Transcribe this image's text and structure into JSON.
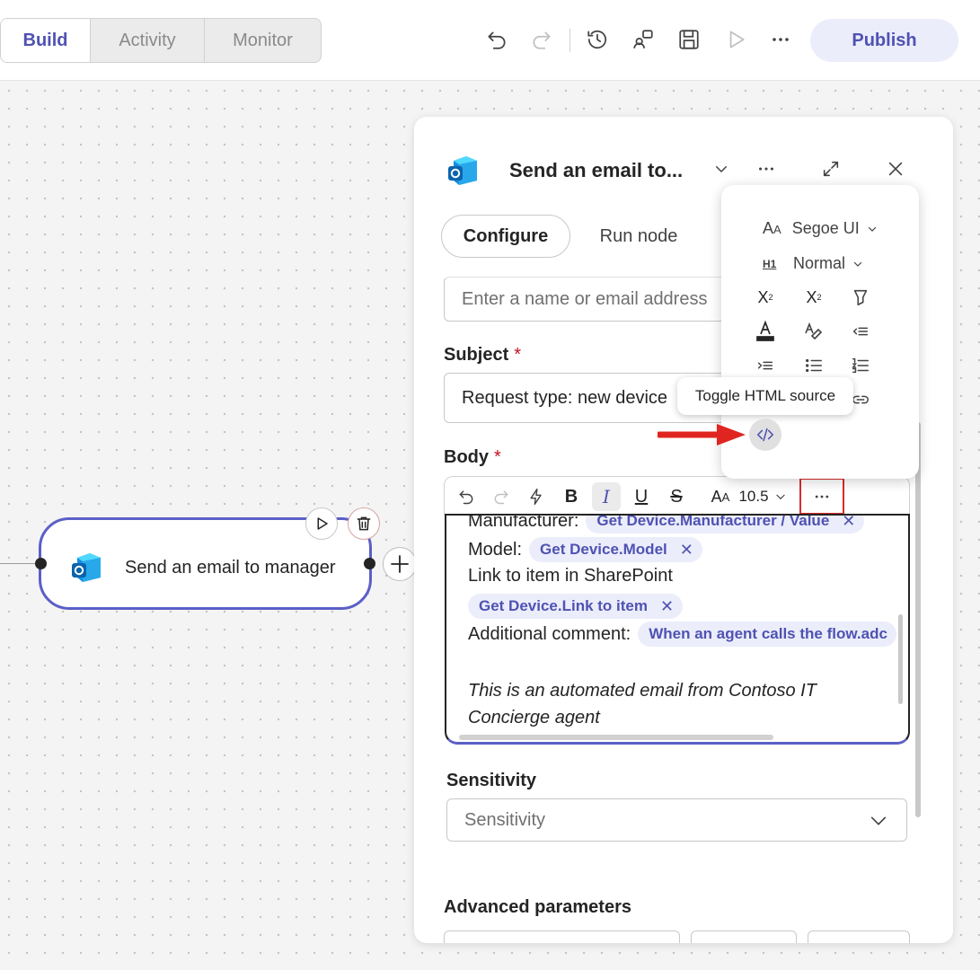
{
  "header": {
    "tabs": [
      {
        "label": "Build",
        "active": true
      },
      {
        "label": "Activity",
        "active": false
      },
      {
        "label": "Monitor",
        "active": false
      }
    ],
    "toolbar_icons": [
      "undo-icon",
      "redo-icon",
      "history-icon",
      "share-icon",
      "save-icon",
      "play-icon",
      "more-icon"
    ],
    "publish_label": "Publish"
  },
  "canvas": {
    "node": {
      "title": "Send an email to manager",
      "icon": "outlook-icon"
    }
  },
  "panel": {
    "title": "Send an email to...",
    "tabs": [
      {
        "label": "Configure",
        "active": true
      },
      {
        "label": "Run node",
        "active": false
      }
    ],
    "to_field": {
      "placeholder": "Enter a name or email address"
    },
    "subject": {
      "label": "Subject",
      "required": "*",
      "value": "Request type: new device"
    },
    "body": {
      "label": "Body",
      "required": "*",
      "font_size": "10.5",
      "lines": [
        {
          "text": "Manufacturer:",
          "token": "Get Device.Manufacturer / Value"
        },
        {
          "text": "Model:",
          "token": "Get Device.Model"
        },
        {
          "text": "Link to item in SharePoint"
        },
        {
          "token": "Get Device.Link to item"
        },
        {
          "text": "Additional comment:",
          "token": "When an agent calls the flow.adc"
        }
      ],
      "footer_text": "This is an automated email from Contoso IT Concierge agent"
    },
    "sensitivity": {
      "label": "Sensitivity",
      "placeholder": "Sensitivity"
    },
    "advanced_label": "Advanced parameters"
  },
  "format_menu": {
    "font_name": "Segoe UI",
    "heading": "Normal",
    "tooltip": "Toggle HTML source"
  },
  "colors": {
    "accent": "#5b5fc7",
    "publish_bg": "#ebedfb",
    "highlight_red": "#d92c2c"
  }
}
